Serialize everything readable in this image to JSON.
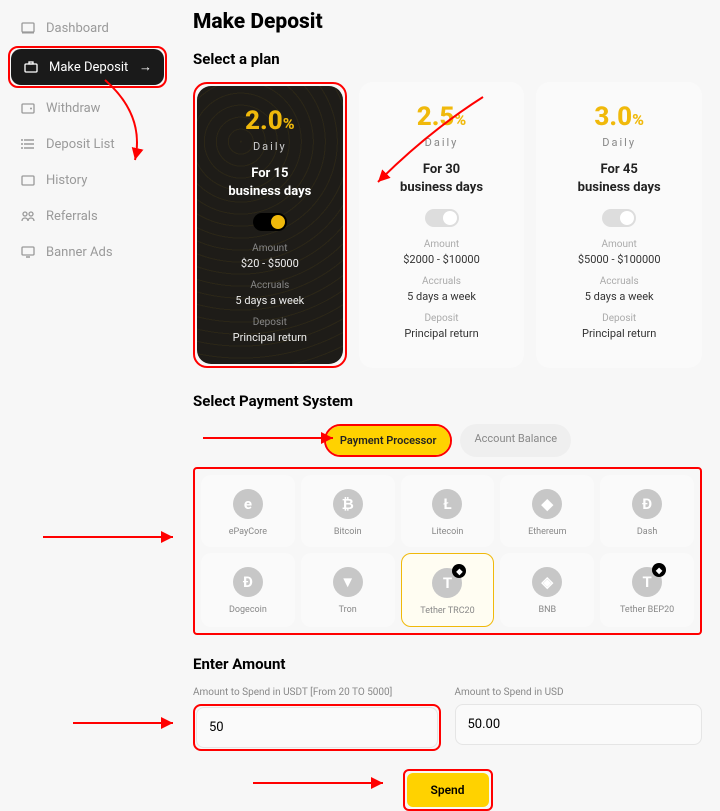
{
  "sidebar": {
    "items": [
      {
        "label": "Dashboard"
      },
      {
        "label": "Make Deposit"
      },
      {
        "label": "Withdraw"
      },
      {
        "label": "Deposit List"
      },
      {
        "label": "History"
      },
      {
        "label": "Referrals"
      },
      {
        "label": "Banner Ads"
      }
    ]
  },
  "page": {
    "title": "Make Deposit",
    "select_plan": "Select a plan",
    "select_payment": "Select Payment System",
    "enter_amount": "Enter Amount"
  },
  "plans": [
    {
      "rate": "2.0",
      "pct": "%",
      "daily": "Daily",
      "for1": "For 15",
      "for2": "business days",
      "amount_lbl": "Amount",
      "amount_val": "$20 - $5000",
      "accruals_lbl": "Accruals",
      "accruals_val": "5 days a week",
      "deposit_lbl": "Deposit",
      "deposit_val": "Principal return"
    },
    {
      "rate": "2.5",
      "pct": "%",
      "daily": "Daily",
      "for1": "For 30",
      "for2": "business days",
      "amount_lbl": "Amount",
      "amount_val": "$2000 - $10000",
      "accruals_lbl": "Accruals",
      "accruals_val": "5 days a week",
      "deposit_lbl": "Deposit",
      "deposit_val": "Principal return"
    },
    {
      "rate": "3.0",
      "pct": "%",
      "daily": "Daily",
      "for1": "For 45",
      "for2": "business days",
      "amount_lbl": "Amount",
      "amount_val": "$5000 - $100000",
      "accruals_lbl": "Accruals",
      "accruals_val": "5 days a week",
      "deposit_lbl": "Deposit",
      "deposit_val": "Principal return"
    }
  ],
  "pay_tabs": {
    "processor": "Payment Processor",
    "balance": "Account Balance"
  },
  "pay_methods": [
    {
      "name": "ePayCore",
      "glyph": "e"
    },
    {
      "name": "Bitcoin",
      "glyph": "₿"
    },
    {
      "name": "Litecoin",
      "glyph": "Ł"
    },
    {
      "name": "Ethereum",
      "glyph": "◆"
    },
    {
      "name": "Dash",
      "glyph": "Đ"
    },
    {
      "name": "Dogecoin",
      "glyph": "Ð"
    },
    {
      "name": "Tron",
      "glyph": "▼"
    },
    {
      "name": "Tether TRC20",
      "glyph": "T"
    },
    {
      "name": "BNB",
      "glyph": "◈"
    },
    {
      "name": "Tether BEP20",
      "glyph": "T"
    }
  ],
  "amount": {
    "spend_label": "Amount to Spend in USDT [From 20 TO 5000]",
    "spend_value": "50",
    "usd_label": "Amount to Spend in USD",
    "usd_value": "50.00",
    "button": "Spend"
  }
}
